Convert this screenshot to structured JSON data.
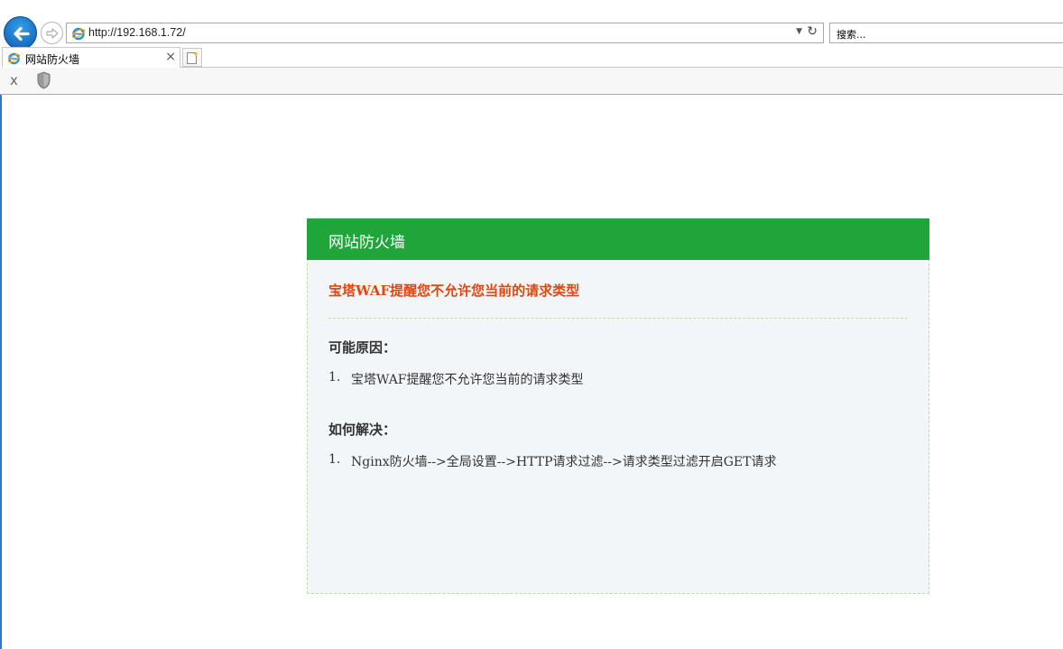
{
  "browser": {
    "address": "http://192.168.1.72/",
    "search_placeholder": "搜索...",
    "tab_title": "网站防火墙",
    "tab_close": "×",
    "cmd_close": "x",
    "colors": {
      "accent": "#1a74c8",
      "bar_bg": "#f7f7f7"
    }
  },
  "waf": {
    "header_title": "网站防火墙",
    "alert": "宝塔WAF提醒您不允许您当前的请求类型",
    "reasons_title": "可能原因：",
    "reasons": [
      {
        "num": "1.",
        "text": "宝塔WAF提醒您不允许您当前的请求类型"
      }
    ],
    "solutions_title": "如何解决：",
    "solutions": [
      {
        "num": "1.",
        "text": "Nginx防火墙-->全局设置-->HTTP请求过滤-->请求类型过滤开启GET请求"
      }
    ],
    "colors": {
      "header": "#20a53a",
      "alert": "#e8440c",
      "box_bg": "#f3f6f8"
    }
  }
}
